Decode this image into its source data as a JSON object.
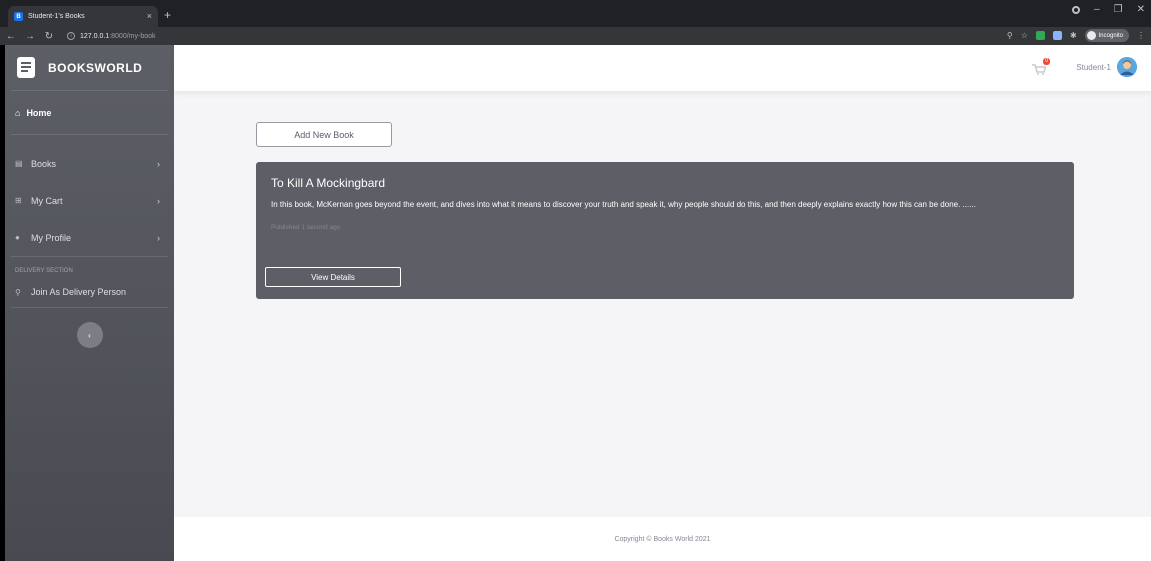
{
  "browser": {
    "tab_title": "Student-1's Books",
    "tab_close": "×",
    "new_tab": "+",
    "url_host": "127.0.0.1",
    "url_path": ":8000/my-book",
    "incognito_label": "Incognito"
  },
  "sidebar": {
    "brand": "BOOKSWORLD",
    "home_label": "Home",
    "items": [
      {
        "label": "Books",
        "icon": "book-icon"
      },
      {
        "label": "My Cart",
        "icon": "cart-icon"
      },
      {
        "label": "My Profile",
        "icon": "user-icon"
      }
    ],
    "section_heading": "DELIVERY SECTION",
    "delivery_item": "Join As Delivery Person",
    "toggle_glyph": "‹"
  },
  "topbar": {
    "cart_count": "0",
    "user_name": "Student-1"
  },
  "main": {
    "add_button": "Add New Book",
    "book": {
      "title": "To Kill A Mockingbard",
      "description": "In this book, McKernan goes beyond the event, and dives into what it means to discover your truth and speak it, why people should do this, and then deeply explains exactly how this can be done. ......",
      "published": "Published 1 second ago",
      "view_button": "View Details"
    }
  },
  "footer": {
    "copyright": "Copyright © Books World 2021"
  },
  "colors": {
    "sidebar": "#5d5f67",
    "card": "#5d5e66",
    "badge": "#e74a3b"
  }
}
